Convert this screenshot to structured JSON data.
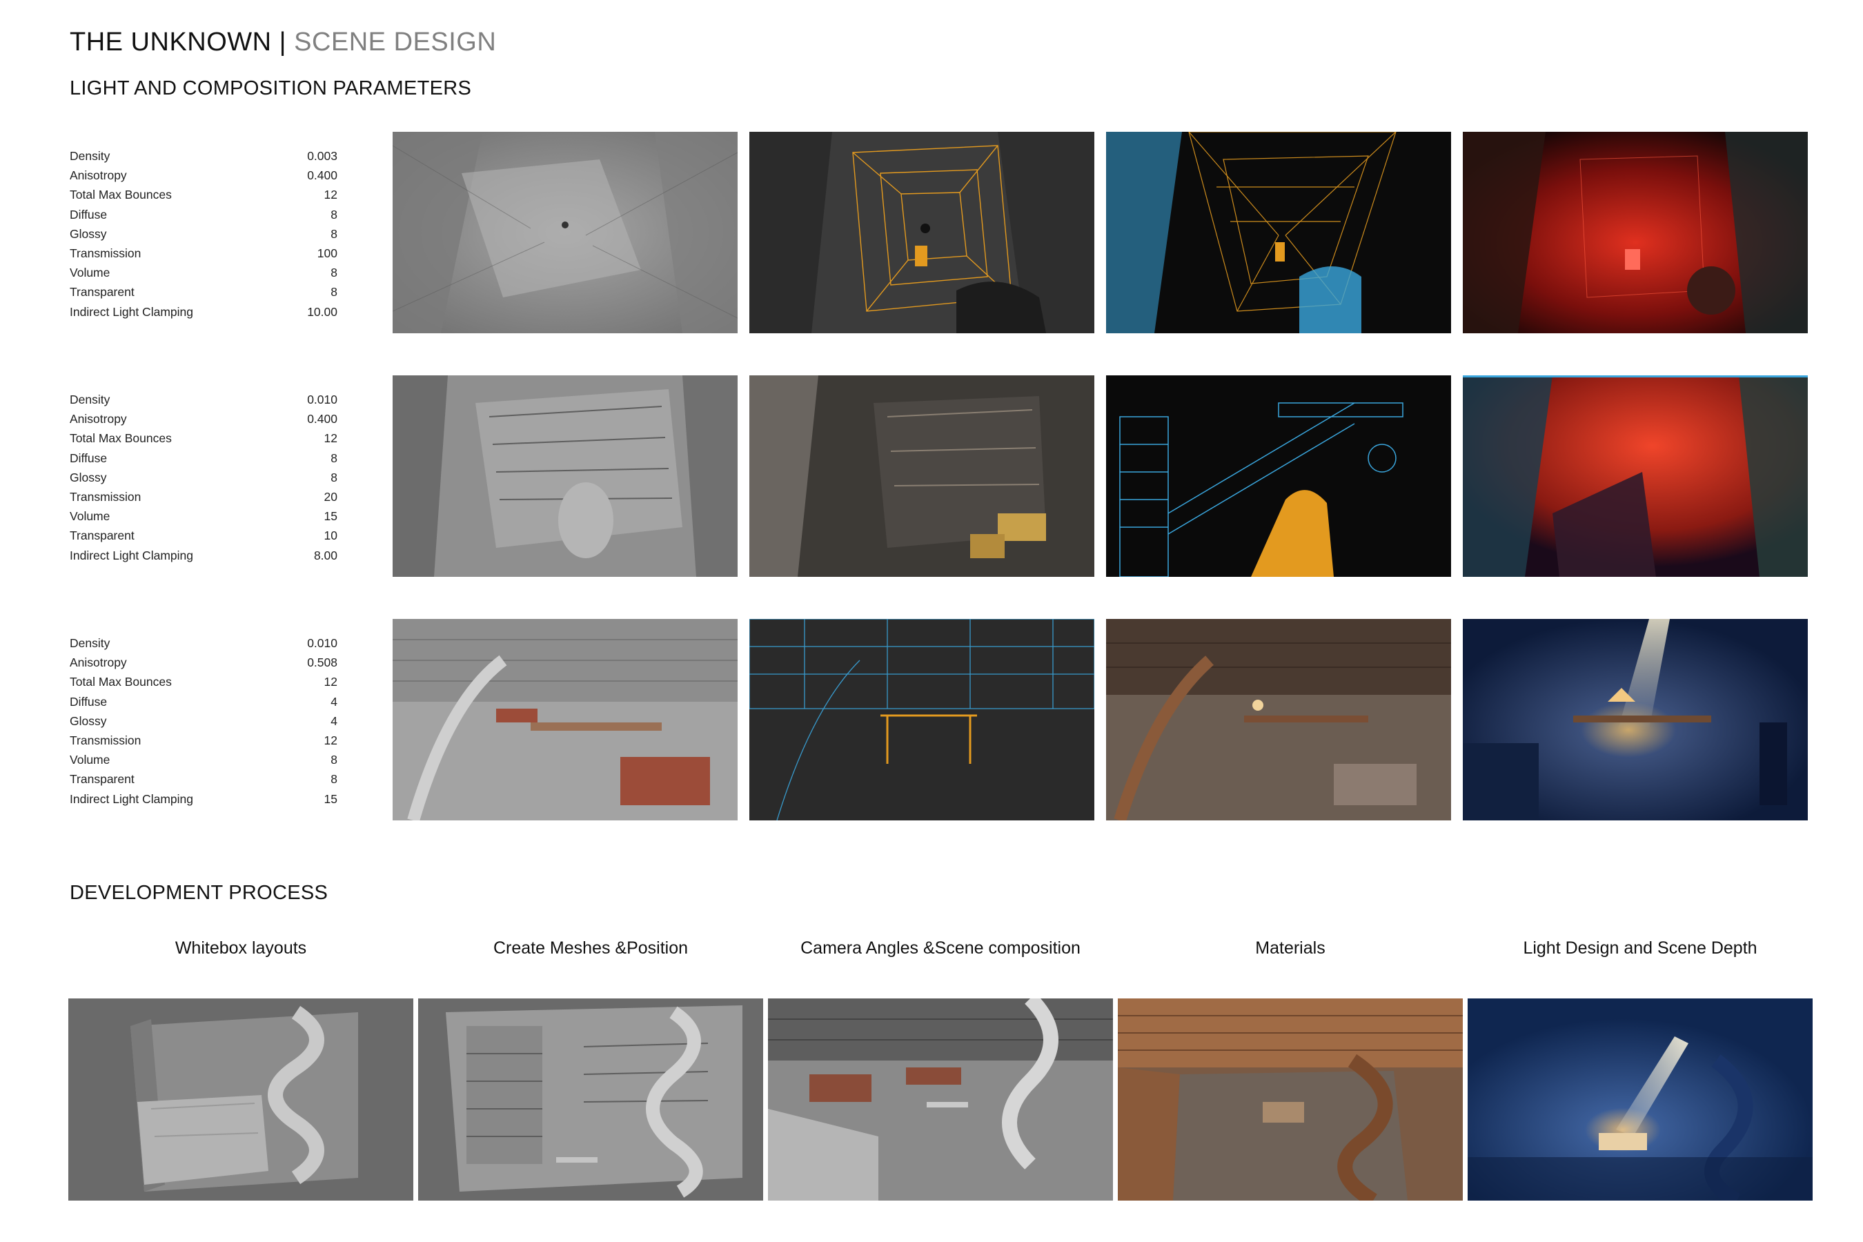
{
  "header": {
    "title_main": "THE UNKNOWN",
    "title_sep": "|",
    "title_sub": "SCENE DESIGN",
    "section1": "LIGHT AND COMPOSITION PARAMETERS",
    "section2": "DEVELOPMENT PROCESS"
  },
  "param_sets": [
    [
      {
        "label": "Density",
        "value": "0.003"
      },
      {
        "label": "Anisotropy",
        "value": "0.400"
      },
      {
        "label": "Total Max Bounces",
        "value": "12"
      },
      {
        "label": "Diffuse",
        "value": "8"
      },
      {
        "label": "Glossy",
        "value": "8"
      },
      {
        "label": "Transmission",
        "value": "100"
      },
      {
        "label": "Volume",
        "value": "8"
      },
      {
        "label": "Transparent",
        "value": "8"
      },
      {
        "label": "Indirect Light Clamping",
        "value": "10.00"
      }
    ],
    [
      {
        "label": "Density",
        "value": "0.010"
      },
      {
        "label": "Anisotropy",
        "value": "0.400"
      },
      {
        "label": "Total Max Bounces",
        "value": "12"
      },
      {
        "label": "Diffuse",
        "value": "8"
      },
      {
        "label": "Glossy",
        "value": "8"
      },
      {
        "label": "Transmission",
        "value": "20"
      },
      {
        "label": "Volume",
        "value": "15"
      },
      {
        "label": "Transparent",
        "value": "10"
      },
      {
        "label": "Indirect Light Clamping",
        "value": "8.00"
      }
    ],
    [
      {
        "label": "Density",
        "value": "0.010"
      },
      {
        "label": "Anisotropy",
        "value": "0.508"
      },
      {
        "label": "Total Max Bounces",
        "value": "12"
      },
      {
        "label": "Diffuse",
        "value": "4"
      },
      {
        "label": "Glossy",
        "value": "4"
      },
      {
        "label": "Transmission",
        "value": "12"
      },
      {
        "label": "Volume",
        "value": "8"
      },
      {
        "label": "Transparent",
        "value": "8"
      },
      {
        "label": "Indirect Light Clamping",
        "value": "15"
      }
    ]
  ],
  "dev_steps": [
    "Whitebox layouts",
    "Create Meshes &Position",
    "Camera Angles &Scene composition",
    "Materials",
    "Light Design and Scene Depth"
  ],
  "colors": {
    "wire_orange": "#e39a1f",
    "wire_blue": "#3aa6dd",
    "red_light": "#d9261c",
    "night_blue": "#1d3a73",
    "wood": "#8a5a3a",
    "clay_gray": "#9a9a9a"
  }
}
